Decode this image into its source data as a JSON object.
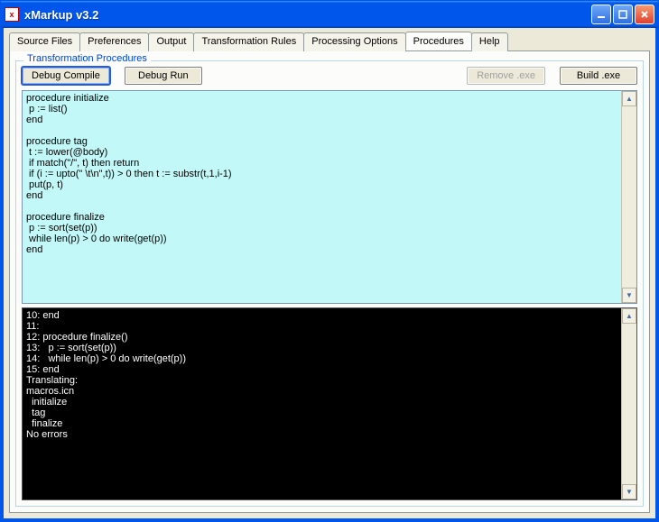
{
  "titlebar": {
    "title": "xMarkup v3.2"
  },
  "tabs": {
    "items": [
      {
        "label": "Source Files"
      },
      {
        "label": "Preferences"
      },
      {
        "label": "Output"
      },
      {
        "label": "Transformation Rules"
      },
      {
        "label": "Processing Options"
      },
      {
        "label": "Procedures"
      },
      {
        "label": "Help"
      }
    ],
    "active_index": 5
  },
  "group": {
    "legend": "Transformation Procedures",
    "buttons": {
      "debug_compile": "Debug Compile",
      "debug_run": "Debug Run",
      "remove_exe": "Remove .exe",
      "build_exe": "Build .exe"
    }
  },
  "code": "procedure initialize\n p := list()\nend\n\nprocedure tag\n t := lower(@body)\n if match(\"/\", t) then return\n if (i := upto(\" \\t\\n\",t)) > 0 then t := substr(t,1,i-1)\n put(p, t)\nend\n\nprocedure finalize\n p := sort(set(p))\n while len(p) > 0 do write(get(p))\nend",
  "console": "10: end\n11:\n12: procedure finalize()\n13:   p := sort(set(p))\n14:   while len(p) > 0 do write(get(p))\n15: end\nTranslating:\nmacros.icn\n  initialize\n  tag\n  finalize\nNo errors"
}
